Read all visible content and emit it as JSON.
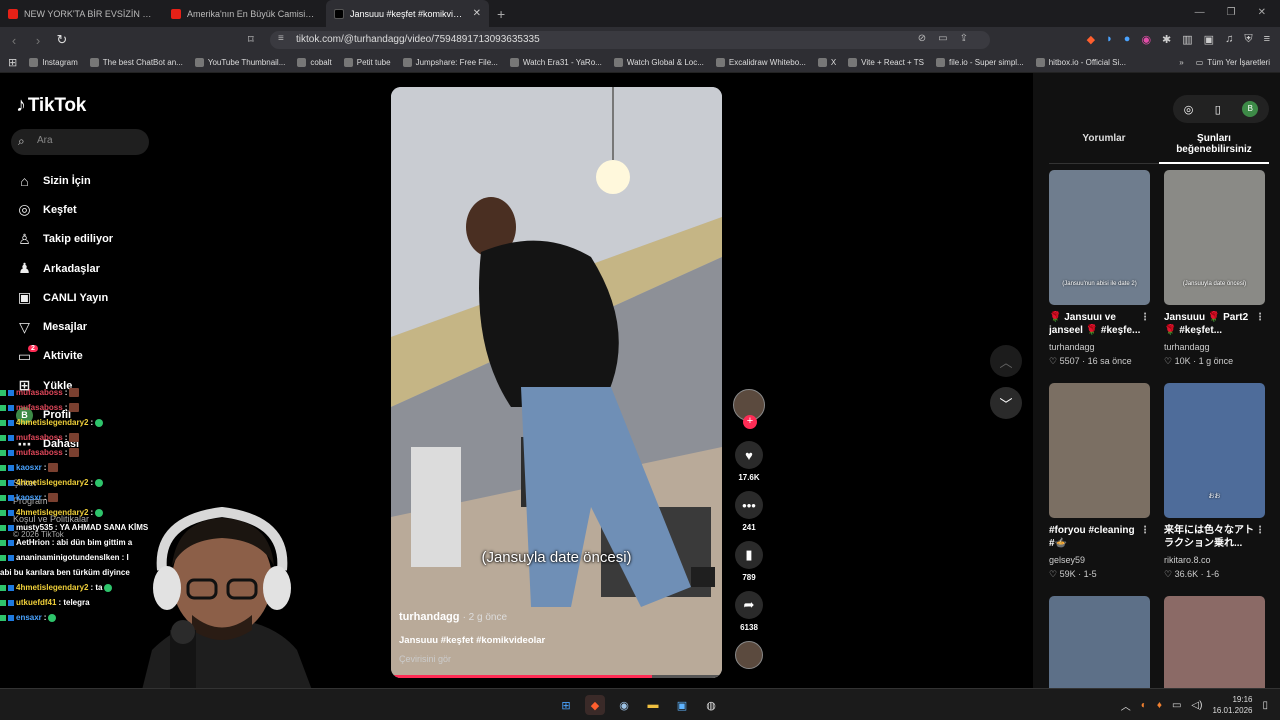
{
  "browser": {
    "tabs": [
      {
        "title": "NEW YORK'TA BİR EVSİZİN HAYATI -",
        "icon": "youtube-icon"
      },
      {
        "title": "Amerika'nın En Büyük Camisine Gittim",
        "icon": "youtube-icon"
      },
      {
        "title": "Jansuuu #keşfet #komikvideolar",
        "icon": "tiktok-icon",
        "active": true
      }
    ],
    "url": "tiktok.com/@turhandagg/video/7594891713093635335",
    "bookmarks": [
      "Instagram",
      "The best ChatBot an...",
      "YouTube Thumbnail...",
      "cobalt",
      "Petit tube",
      "Jumpshare: Free File...",
      "Watch Era31 - YaRo...",
      "Watch Global & Loc...",
      "Excalidraw Whitebo...",
      "X",
      "Vite + React + TS",
      "file.io - Super simpl...",
      "hitbox.io - Official Si..."
    ],
    "all_bookmarks": "Tüm Yer İşaretleri"
  },
  "tiktok": {
    "logo": "TikTok",
    "search_placeholder": "Ara",
    "nav": [
      {
        "label": "Sizin İçin",
        "icon": "home-icon",
        "glyph": "⌂"
      },
      {
        "label": "Keşfet",
        "icon": "compass-icon",
        "glyph": "◎"
      },
      {
        "label": "Takip ediliyor",
        "icon": "following-icon",
        "glyph": "♙"
      },
      {
        "label": "Arkadaşlar",
        "icon": "friends-icon",
        "glyph": "♟"
      },
      {
        "label": "CANLI Yayın",
        "icon": "live-icon",
        "glyph": "▣"
      },
      {
        "label": "Mesajlar",
        "icon": "messages-icon",
        "glyph": "▽"
      },
      {
        "label": "Aktivite",
        "icon": "activity-icon",
        "glyph": "▭",
        "badge": "2"
      },
      {
        "label": "Yükle",
        "icon": "upload-icon",
        "glyph": "⊞"
      },
      {
        "label": "Profil",
        "icon": "profile-avatar-icon",
        "glyph": "B"
      },
      {
        "label": "Dahası",
        "icon": "more-icon",
        "glyph": "⋯"
      }
    ],
    "footer": [
      "Şirket",
      "Program",
      "Koşul ve Politikalar",
      "© 2026 TikTok"
    ],
    "video": {
      "caption": "(Jansuyla date öncesi)",
      "author": "turhandagg",
      "age": "· 2 g önce",
      "description": "Jansuuu #keşfet #komikvideolar",
      "translate": "Çevirisini gör",
      "progress": 0.79
    },
    "actions": {
      "likes": "17.6K",
      "comments": "241",
      "saves": "789",
      "shares": "6138"
    },
    "right": {
      "tabs": [
        "Yorumlar",
        "Şunları beğenebilirsiniz"
      ],
      "cards": [
        {
          "title": "🌹 Jansuuı ve janseel 🌹 #keşfe...",
          "user": "turhandagg",
          "stats": "♡ 5507 · 16 sa önce",
          "overlay": "(Jansuu'nun abisi ile date 2)",
          "bg": "#6f7d8e"
        },
        {
          "title": "Jansuuu 🌹 Part2 🌹 #keşfet...",
          "user": "turhandagg",
          "stats": "♡ 10K · 1 g önce",
          "overlay": "(Jansuuyla date öncesi)",
          "bg": "#8a8a86"
        },
        {
          "title": "#foryou #cleaning #🍲",
          "user": "gelsey59",
          "stats": "♡ 59K · 1-5",
          "overlay": "",
          "bg": "#7b6f63"
        },
        {
          "title": "来年には色々なアトラクション乗れ...",
          "user": "rikitaro.8.co",
          "stats": "♡ 36.6K · 1-6",
          "overlay": "おお",
          "bg": "#4e6c9a"
        },
        {
          "title": "",
          "user": "",
          "stats": "",
          "overlay": "",
          "bg": "#5d7088"
        },
        {
          "title": "",
          "user": "",
          "stats": "",
          "overlay": "",
          "bg": "#8b6a66"
        }
      ]
    }
  },
  "chat": [
    {
      "user": "mufasaboss",
      "color": "#e0475a",
      "msg": ":"
    },
    {
      "user": "mufasaboss",
      "color": "#e0475a",
      "msg": ":"
    },
    {
      "user": "4hmetislegendary2",
      "color": "#f0d03a",
      "msg": ":"
    },
    {
      "user": "mufasaboss",
      "color": "#e0475a",
      "msg": ":"
    },
    {
      "user": "mufasaboss",
      "color": "#e0475a",
      "msg": ":"
    },
    {
      "user": "kaosxr",
      "color": "#4aa3ff",
      "msg": ":"
    },
    {
      "user": "4hmetislegendary2",
      "color": "#f0d03a",
      "msg": ":"
    },
    {
      "user": "kaosxr",
      "color": "#4aa3ff",
      "msg": ":"
    },
    {
      "user": "4hmetislegendary2",
      "color": "#f0d03a",
      "msg": ":"
    },
    {
      "user": "musty535",
      "color": "#ffffff",
      "msg": ": YA AHMAD SANA KİMS"
    },
    {
      "user": "AetHrion",
      "color": "#ffffff",
      "msg": ": abi dün bim gittim a"
    },
    {
      "user": "ananinaminigotundenslken",
      "color": "#ffffff",
      "msg": ": I"
    },
    {
      "user": "",
      "color": "#ffffff",
      "msg": "abi bu karılara ben türküm diyince"
    },
    {
      "user": "4hmetislegendary2",
      "color": "#f0d03a",
      "msg": ": ta"
    },
    {
      "user": "utkuefdf41",
      "color": "#f0d03a",
      "msg": ": telegra"
    },
    {
      "user": "ensaxr",
      "color": "#4aa3ff",
      "msg": ":"
    }
  ],
  "taskbar": {
    "time": "19:16",
    "date": "16.01.2026"
  },
  "colors": {
    "accent": "#fe2c55",
    "bg": "#000000"
  }
}
